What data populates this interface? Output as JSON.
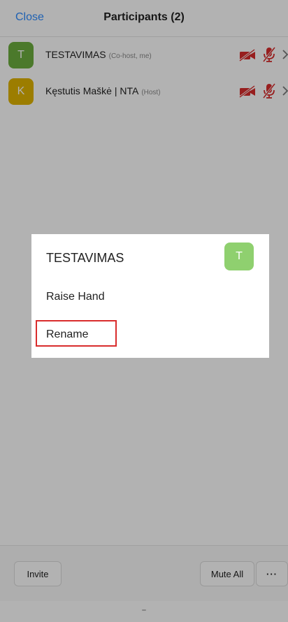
{
  "header": {
    "close_label": "Close",
    "title": "Participants (2)"
  },
  "participants": [
    {
      "initial": "T",
      "name": "TESTAVIMAS",
      "role": "(Co-host, me)",
      "avatar_color": "#6cae3e",
      "video": "off",
      "audio": "muted"
    },
    {
      "initial": "K",
      "name": "Kęstutis Maškė | NTA",
      "role": "(Host)",
      "avatar_color": "#e0b300",
      "video": "off",
      "audio": "muted"
    }
  ],
  "dialog": {
    "name": "TESTAVIMAS",
    "initial": "T",
    "avatar_color": "#8fd06f",
    "items": [
      {
        "label": "Raise Hand"
      },
      {
        "label": "Rename"
      }
    ]
  },
  "footer": {
    "invite_label": "Invite",
    "mute_all_label": "Mute All",
    "more_label": "···"
  },
  "colors": {
    "accent": "#2d8cff",
    "muted_red": "#d92c2c",
    "highlight_border": "#d92c2c"
  },
  "icons": {
    "video": "video-off-icon",
    "audio": "mic-muted-icon",
    "chevron": "chevron-right-icon"
  }
}
